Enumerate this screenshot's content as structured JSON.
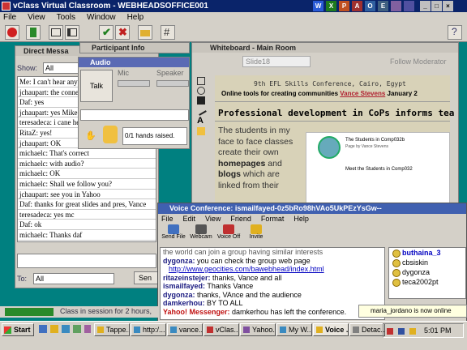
{
  "window": {
    "title": "vClass Virtual Classroom - WEBHEADSOFFICE001"
  },
  "menu": [
    "File",
    "View",
    "Tools",
    "Window",
    "Help"
  ],
  "toolbar": {
    "icons": [
      "record-icon",
      "exit-icon",
      "layout-icon",
      "layout2-icon",
      "check-icon",
      "cross-icon",
      "folder-icon",
      "whiteboard-icon"
    ]
  },
  "direct_messages": {
    "title": "Direct Messa",
    "show_label": "Show:",
    "show_value": "All",
    "lines": [
      "Me: I can't hear anyt",
      "jchaupart: the connec",
      "Daf: yes",
      "jchaupart: yes Mike",
      "teresadeca: i cane hear",
      "RitaZ: yes!",
      "jchaupart: OK",
      "michaelc: That's correct",
      "michaelc: with audio?",
      "michaelc: OK",
      "michaelc: Shall we follow you?",
      "jchaupart: see you in Yahoo",
      "Daf: thanks for great slides and pres, Vance",
      "teresadeca: yes mc",
      "Daf: ok",
      "michaelc: Thanks daf"
    ],
    "to_label": "To:",
    "to_value": "All",
    "send_label": "Sen"
  },
  "participant": {
    "title": "Participant Info"
  },
  "audio": {
    "title": "Audio",
    "talk": "Talk",
    "mic": "Mic",
    "speaker": "Speaker",
    "hands": "0/1 hands raised."
  },
  "whiteboard": {
    "title": "Whiteboard - Main Room",
    "slide": "Slide18",
    "follow": "Follow Moderator",
    "line1": "9th EFL Skills Conference, Cairo, Egypt",
    "line2_a": "Online tools for creating communities ",
    "line2_b": "Vance Stevens",
    "line2_c": " January 2",
    "heading": "Professional development in CoPs informs tea",
    "body": [
      {
        "text": "The students in my",
        "bold": false
      },
      {
        "text": "face to face classes",
        "bold": false
      },
      {
        "text": "create their own",
        "bold": false
      },
      {
        "text": "homepages",
        "bold": true,
        "rest": " and"
      },
      {
        "text": "blogs",
        "bold": true,
        "rest": " which are"
      },
      {
        "text": "linked from their",
        "bold": false
      }
    ],
    "site_title": "The Students in Comp032b",
    "site_sub": "Meet the Students in Comp032",
    "site_small": "Page by Vance Stevens"
  },
  "voice": {
    "title": "Voice Conference: ismailfayed-0z5bRo98hVAo5UkPEzYsGw--",
    "menu": [
      "File",
      "Edit",
      "View",
      "Friend",
      "Format",
      "Help"
    ],
    "buttons": [
      "Send File",
      "Webcam",
      "Voice Off",
      "Invite"
    ],
    "lines": [
      {
        "name": "",
        "text": "the world can join a group having similar interests",
        "cls": "cut"
      },
      {
        "name": "dygonza:",
        "text": " you can check the group web page"
      },
      {
        "name": "",
        "text": "http://www.geocities.com/bawebhead/index.html",
        "cls": "link"
      },
      {
        "name": "ritazeinstejer:",
        "text": " thanks, Vance and all"
      },
      {
        "name": "ismailfayed:",
        "text": " Thanks Vance"
      },
      {
        "name": "dygonza:",
        "text": " thanks, VAnce and the audience"
      },
      {
        "name": "damkerhou:",
        "text": " BY TO ALL"
      },
      {
        "name": "Yahoo! Messenger:",
        "text": " damkerhou has left the conference.",
        "cls": "yahoo"
      }
    ],
    "users": [
      "buthaina_3",
      "cbsiskin",
      "dygonza",
      "teca2002pt"
    ]
  },
  "status": {
    "text": "Class in session for 2 hours,"
  },
  "notification": {
    "text": "maria_jordano is now online"
  },
  "taskbar": {
    "start": "Start",
    "tasks": [
      "Tappe...",
      "http:/...",
      "vance...",
      "vClas...",
      "Yahoo...",
      "My W...",
      "Voice ...",
      "Detac..."
    ],
    "time": "5:01 PM"
  }
}
